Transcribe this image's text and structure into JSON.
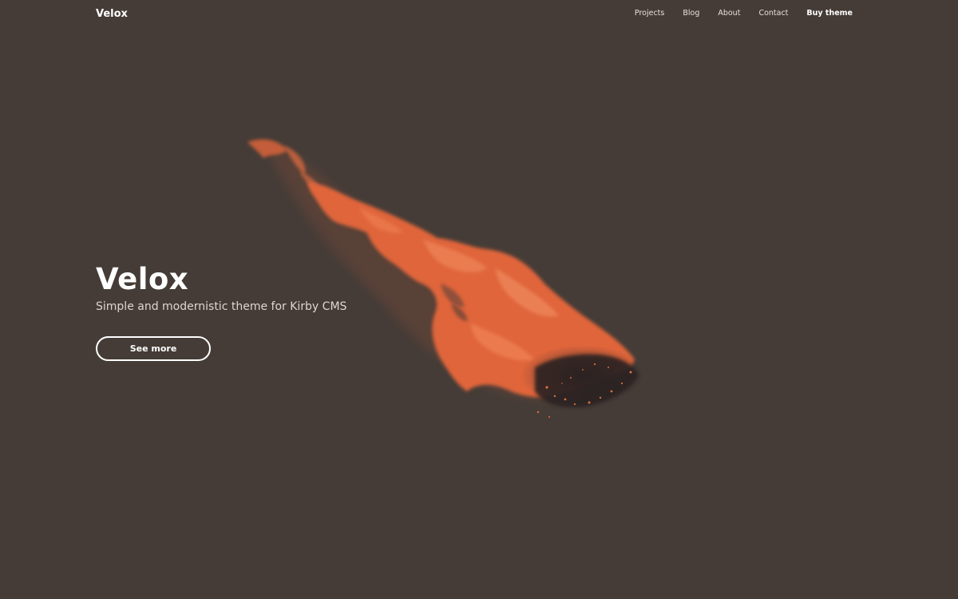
{
  "header": {
    "brand": "Velox",
    "nav": [
      "Projects",
      "Blog",
      "About",
      "Contact",
      "Buy theme"
    ]
  },
  "hero": {
    "title": "Velox",
    "subtitle": "Simple and modernistic theme for Kirby CMS",
    "button_label": "See more",
    "image": "flame-image"
  },
  "colors": {
    "background": "#453c37",
    "accent": "#e0653a",
    "text": "#ffffff"
  }
}
